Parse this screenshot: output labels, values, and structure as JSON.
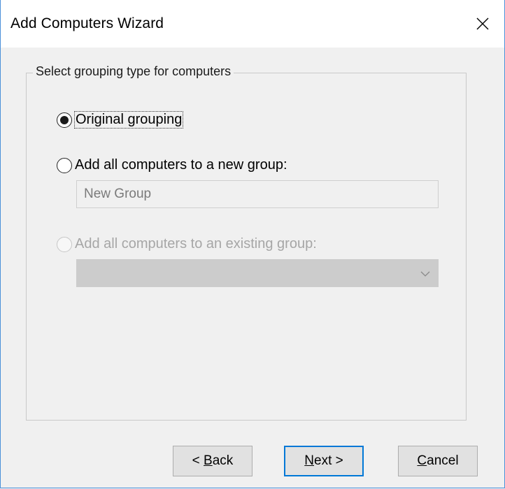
{
  "window": {
    "title": "Add Computers Wizard"
  },
  "groupbox": {
    "legend": "Select grouping type for computers"
  },
  "options": {
    "original": {
      "label": "Original grouping",
      "selected": true,
      "enabled": true
    },
    "new_group": {
      "label": "Add all computers to a new group:",
      "selected": false,
      "enabled": true,
      "input_value": "New Group"
    },
    "existing_group": {
      "label": "Add all computers to an existing group:",
      "selected": false,
      "enabled": false,
      "dropdown_value": ""
    }
  },
  "buttons": {
    "back": {
      "prefix": "< ",
      "accel": "B",
      "rest": "ack"
    },
    "next": {
      "accel": "N",
      "rest": "ext >"
    },
    "cancel": {
      "accel": "C",
      "rest": "ancel"
    }
  },
  "colors": {
    "accent": "#0078d7",
    "window_bg": "#f0f0f0",
    "border": "#4a90d9"
  }
}
